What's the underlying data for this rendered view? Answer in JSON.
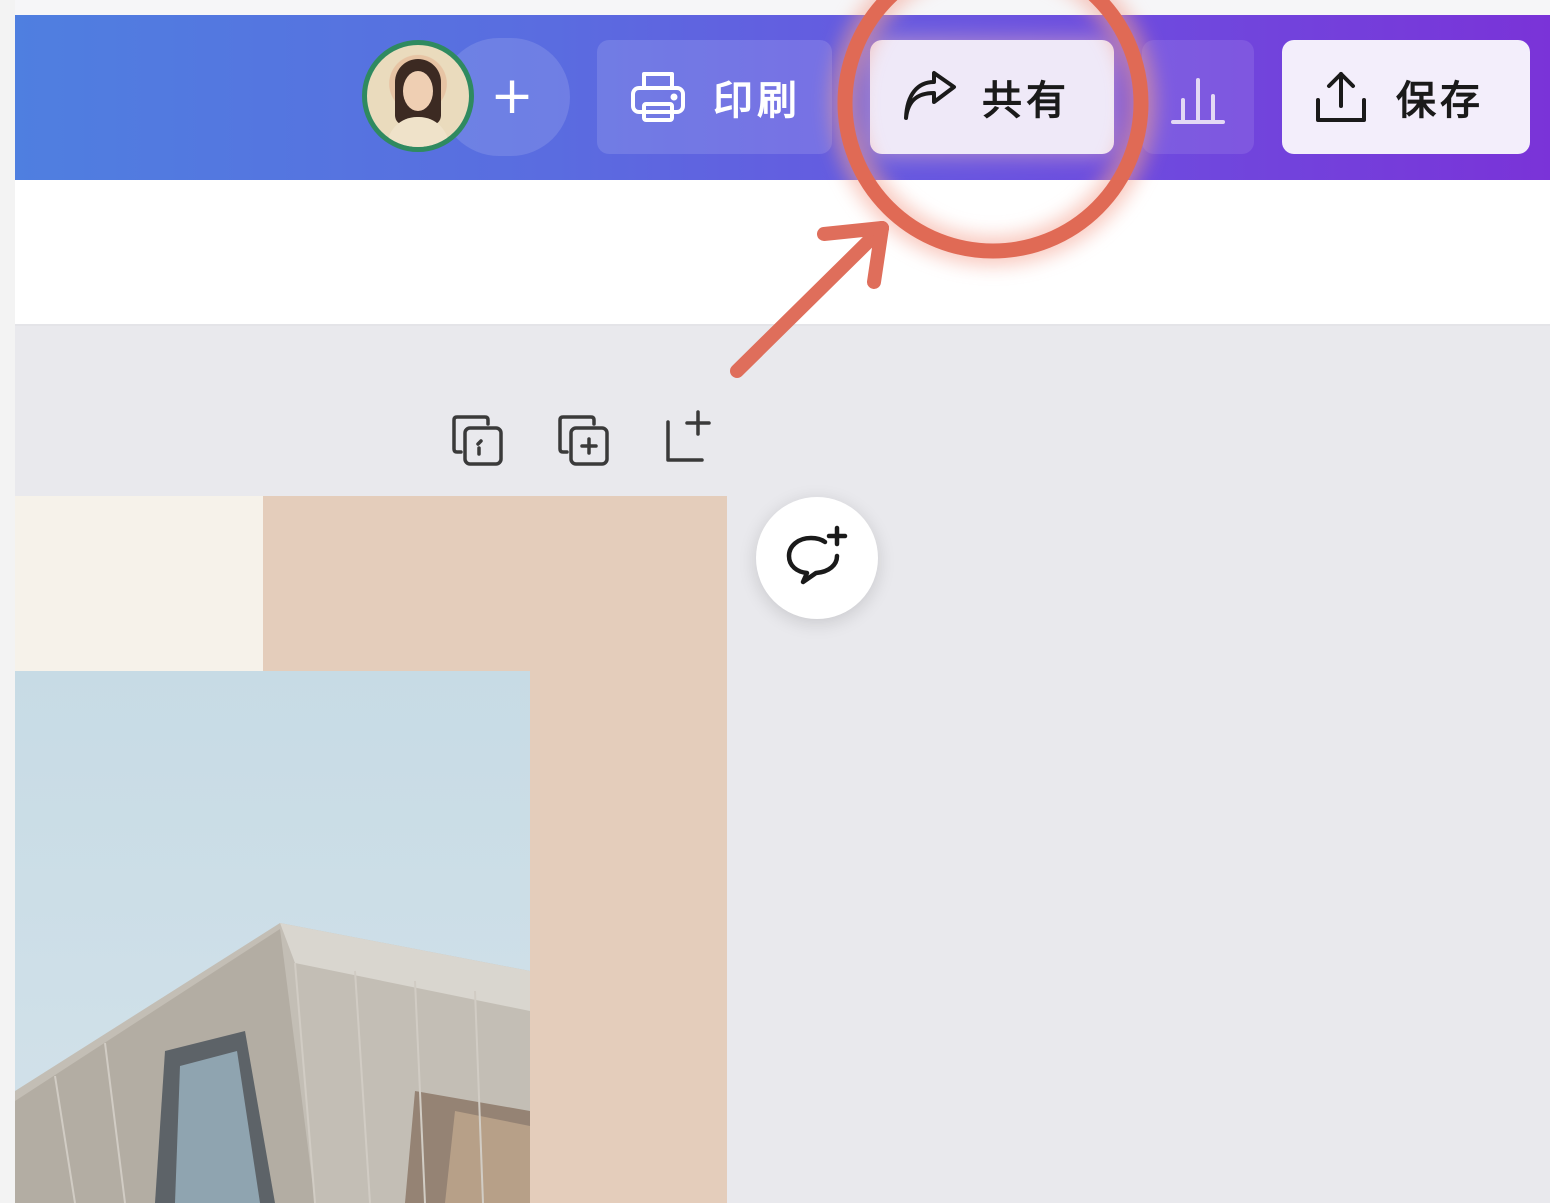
{
  "header": {
    "add_member_symbol": "+",
    "print_label": "印刷",
    "share_label": "共有",
    "save_label": "保存"
  },
  "icons": {
    "print": "printer-icon",
    "share": "share-arrow-icon",
    "insights": "bar-chart-icon",
    "save": "upload-icon",
    "page_lock": "lock-page-icon",
    "page_duplicate": "duplicate-page-icon",
    "page_add": "add-page-icon",
    "comment": "add-comment-icon"
  },
  "colors": {
    "header_gradient_start": "#4f7fe0",
    "header_gradient_end": "#7a33d8",
    "highlight_annotation": "#e06a55",
    "avatar_ring": "#2f8a60",
    "page_beige": "#e4cdbb"
  }
}
